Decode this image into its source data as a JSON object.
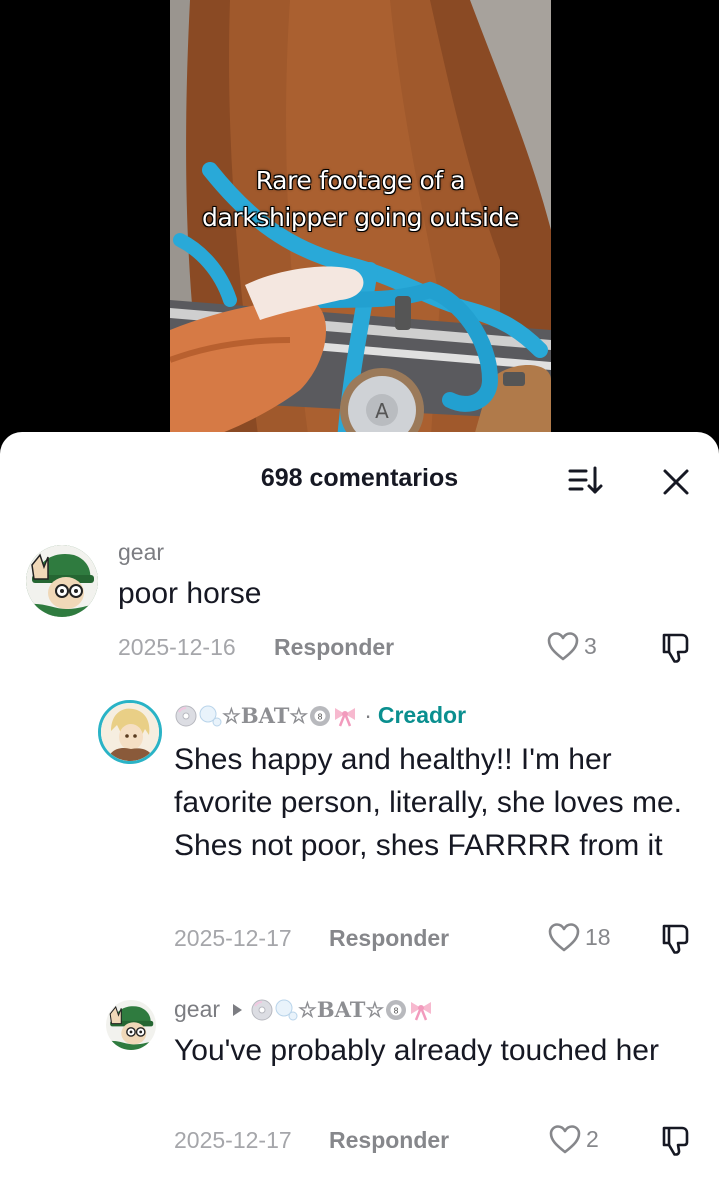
{
  "video": {
    "caption_line1": "Rare footage of a",
    "caption_line2": "darkshipper going outside"
  },
  "comments_header": {
    "count_label": "698 comentarios"
  },
  "comments": [
    {
      "username": "gear",
      "text": "poor horse",
      "date": "2025-12-16",
      "reply_label": "Responder",
      "likes": "3"
    },
    {
      "username": "☆BAT☆",
      "creator_label": "Creador",
      "separator": "·",
      "text": "Shes happy and healthy!! I'm her favorite person, literally, she loves me. Shes not poor, shes FARRRR from it",
      "date": "2025-12-17",
      "reply_label": "Responder",
      "likes": "18"
    },
    {
      "username": "gear",
      "reply_to": "☆BAT☆",
      "text": "You've probably already touched her",
      "date": "2025-12-17",
      "reply_label": "Responder",
      "likes": "2"
    }
  ],
  "icons": {
    "sort": "sort-icon",
    "close": "close-icon",
    "like": "heart-outline-icon",
    "dislike": "thumbs-down-icon",
    "reply_arrow": "triangle-right-icon"
  },
  "colors": {
    "creator_accent": "#0a8f8f",
    "text_primary": "#161823",
    "text_secondary": "#86878b",
    "rope_blue": "#29a9d8"
  }
}
